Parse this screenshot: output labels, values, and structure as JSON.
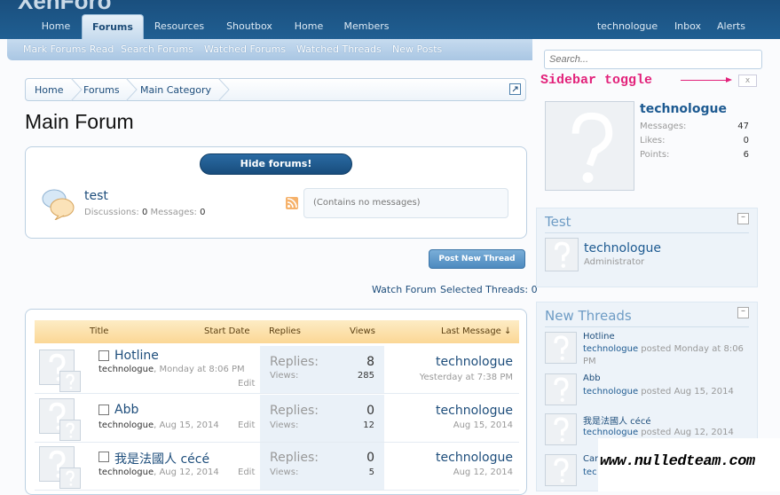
{
  "logo": "XenForo",
  "nav": {
    "tabs": [
      "Home",
      "Forums",
      "Resources",
      "Shoutbox",
      "Home",
      "Members"
    ],
    "active": "Forums",
    "user": "technologue",
    "inbox": "Inbox",
    "alerts": "Alerts"
  },
  "subnav": [
    "Mark Forums Read",
    "Search Forums",
    "Watched Forums",
    "Watched Threads",
    "New Posts"
  ],
  "search": {
    "placeholder": "Search..."
  },
  "annotation": "Sidebar toggle",
  "toggle": "x",
  "breadcrumb": [
    "Home",
    "Forums",
    "Main Category"
  ],
  "title": "Main Forum",
  "hide_forums": "Hide forums!",
  "forum": {
    "name": "test",
    "discussions_label": "Discussions:",
    "discussions": "0",
    "messages_label": "Messages:",
    "messages": "0",
    "latest": "(Contains no messages)"
  },
  "post_thread": "Post New Thread",
  "watch_forum": "Watch Forum",
  "selected_label": "Selected Threads:",
  "selected": "0",
  "columns": {
    "title": "Title",
    "start": "Start Date",
    "replies": "Replies",
    "views": "Views",
    "last": "Last Message ↓"
  },
  "threads": [
    {
      "title": "Hotline",
      "author": "technologue",
      "date": "Monday at 8:06 PM",
      "edit": "Edit",
      "replies_label": "Replies:",
      "replies": "8",
      "views_label": "Views:",
      "views": "285",
      "last_user": "technologue",
      "last_date": "Yesterday at 7:38 PM"
    },
    {
      "title": "Abb",
      "author": "technologue",
      "date": "Aug 15, 2014",
      "edit": "Edit",
      "replies_label": "Replies:",
      "replies": "0",
      "views_label": "Views:",
      "views": "12",
      "last_user": "technologue",
      "last_date": "Aug 15, 2014"
    },
    {
      "title": "我是法國人 cécé",
      "author": "technologue",
      "date": "Aug 12, 2014",
      "edit": "Edit",
      "replies_label": "Replies:",
      "replies": "0",
      "views_label": "Views:",
      "views": "5",
      "last_user": "technologue",
      "last_date": "Aug 12, 2014"
    }
  ],
  "profile": {
    "name": "technologue",
    "stats": [
      {
        "label": "Messages:",
        "value": "47"
      },
      {
        "label": "Likes:",
        "value": "0"
      },
      {
        "label": "Points:",
        "value": "6"
      }
    ]
  },
  "test_block": {
    "title": "Test",
    "user": "technologue",
    "role": "Administrator"
  },
  "new_threads": {
    "title": "New Threads",
    "items": [
      {
        "title": "Hotline",
        "user": "technologue",
        "meta": "posted Monday at 8:06",
        "meta2": "PM"
      },
      {
        "title": "Abb",
        "user": "technologue",
        "meta": "posted Aug 15, 2014",
        "meta2": ""
      },
      {
        "title": "我是法國人 cécé",
        "user": "technologue",
        "meta": "posted Aug 12, 2014",
        "meta2": ""
      },
      {
        "title": "Car",
        "user": "tec",
        "meta": "",
        "meta2": ""
      }
    ]
  },
  "watermark": "www.nulledteam.com"
}
